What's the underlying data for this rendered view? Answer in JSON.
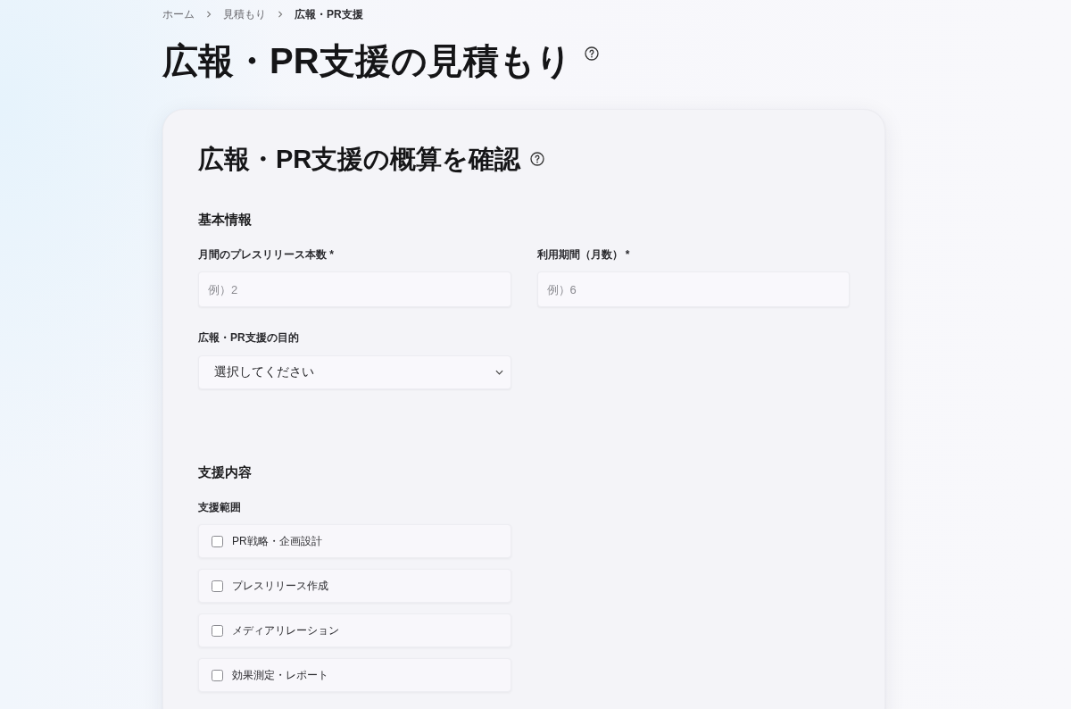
{
  "breadcrumb": [
    {
      "label": "ホーム",
      "current": false
    },
    {
      "label": "見積もり",
      "current": false
    },
    {
      "label": "広報・PR支援",
      "current": true
    }
  ],
  "page_title": "広報・PR支援の見積もり",
  "card": {
    "title": "広報・PR支援の概算を確認",
    "sections": [
      {
        "heading": "基本情報",
        "fields": [
          {
            "kind": "number",
            "label": "月間のプレスリリース本数 *",
            "placeholder": "例）2"
          },
          {
            "kind": "number",
            "label": "利用期間（月数） *",
            "placeholder": "例）6"
          },
          {
            "kind": "select",
            "label": "広報・PR支援の目的",
            "value": "選択してください"
          }
        ]
      },
      {
        "heading": "支援内容",
        "fields": [
          {
            "kind": "checkboxes",
            "label": "支援範囲",
            "options": [
              {
                "label": "PR戦略・企画設計",
                "checked": false
              },
              {
                "label": "プレスリリース作成",
                "checked": false
              },
              {
                "label": "メディアリレーション",
                "checked": false
              },
              {
                "label": "効果測定・レポート",
                "checked": false
              }
            ]
          }
        ]
      }
    ]
  }
}
